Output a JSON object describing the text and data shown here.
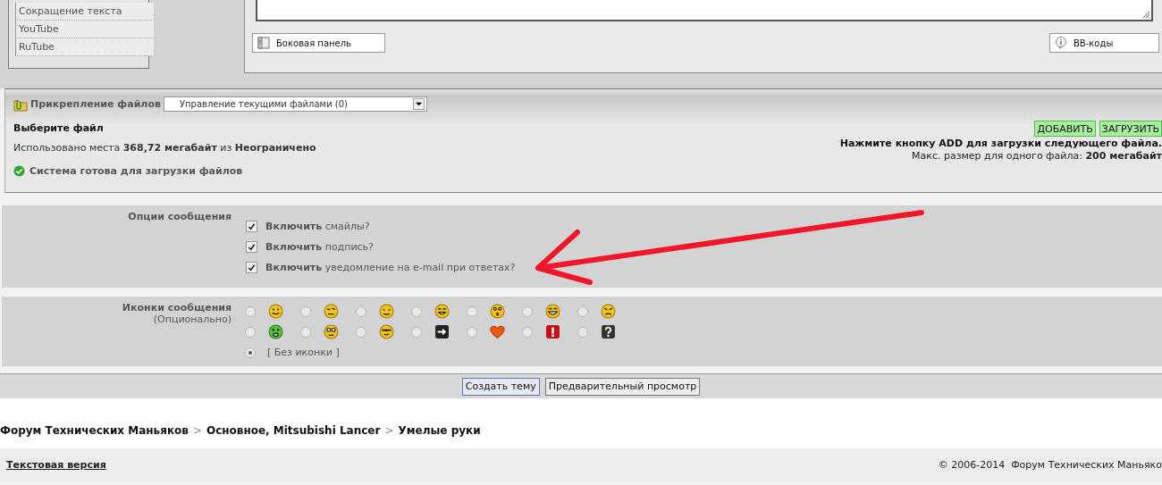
{
  "sidebar": {
    "items": [
      {
        "label": "Сокращение текста"
      },
      {
        "label": "YouTube"
      },
      {
        "label": "RuTube"
      }
    ]
  },
  "editor": {
    "buttons": [
      {
        "label": "Боковая панель",
        "kind": "sidebar"
      },
      {
        "label": "BB-коды",
        "kind": "info"
      }
    ]
  },
  "attachments": {
    "title": "Прикрепление файлов",
    "manage_select": {
      "value": "Управление текущими файлами (0)"
    },
    "choose_label": "Выберите файл",
    "usage": "Использовано места **368,72 мегабайт** из **Неограничено**",
    "status": "Система готова для загрузки файлов",
    "buttons": [
      {
        "label": "ДОБАВИТЬ"
      },
      {
        "label": "ЗАГРУЗИТЬ"
      }
    ],
    "hint": "Нажмите кнопку ADD для загрузки следующего файла.",
    "max_size": "Макс. размер для одного файла: **200 мегабайт**"
  },
  "message_options": {
    "label": "Опции сообщения",
    "options": [
      {
        "label": "**Включить** смайлы?",
        "checked": true
      },
      {
        "label": "**Включить** подпись?",
        "checked": true
      },
      {
        "label": "**Включить** уведомление на e-mail при ответах?",
        "checked": true
      }
    ]
  },
  "annotation": {
    "kind": "arrow"
  },
  "message_icons": {
    "label": "Иконки сообщения",
    "sublabel": "(Опционально)",
    "options": [
      {
        "kind": "smile",
        "selected": false
      },
      {
        "kind": "smirk",
        "selected": false
      },
      {
        "kind": "squint",
        "selected": false
      },
      {
        "kind": "grin",
        "selected": false
      },
      {
        "kind": "surprised",
        "selected": false
      },
      {
        "kind": "laugh",
        "selected": false
      },
      {
        "kind": "angry",
        "selected": false
      },
      {
        "kind": "sick",
        "selected": false
      },
      {
        "kind": "eek",
        "selected": false
      },
      {
        "kind": "cool",
        "selected": false
      },
      {
        "kind": "arrow",
        "selected": false
      },
      {
        "kind": "heart",
        "selected": false
      },
      {
        "kind": "exclaim",
        "selected": false
      },
      {
        "kind": "question",
        "selected": false
      },
      {
        "kind": "none",
        "label": "[ Без иконки ]",
        "selected": true
      }
    ]
  },
  "actions": [
    {
      "label": "Создать тему",
      "kind": "primary"
    },
    {
      "label": "Предварительный просмотр",
      "kind": "normal"
    }
  ],
  "breadcrumb": {
    "separator": ">",
    "items": [
      "Форум Технических Маньяков",
      "Основное, Mitsubishi Lancer",
      "Умелые руки"
    ]
  },
  "footer": {
    "link": "Текстовая версия",
    "copyright": "© 2006-2014  Форум Технических Маньяко"
  }
}
